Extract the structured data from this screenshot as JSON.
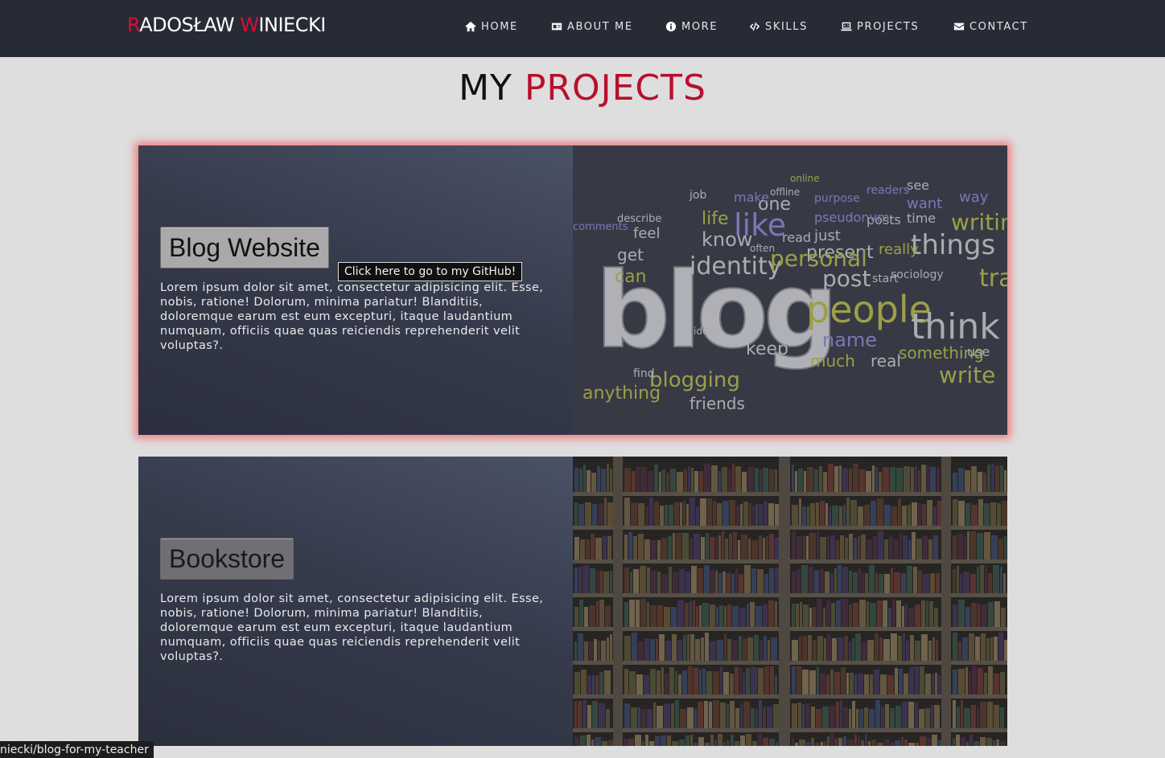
{
  "brand": {
    "first_initial": "R",
    "first_rest": "ADOSŁAW ",
    "last_initial": "W",
    "last_rest": "INIECKI"
  },
  "nav": {
    "items": [
      {
        "label": "HOME",
        "icon": "home-icon"
      },
      {
        "label": "ABOUT ME",
        "icon": "id-card-icon"
      },
      {
        "label": "MORE",
        "icon": "info-circle-icon"
      },
      {
        "label": "SKILLS",
        "icon": "code-icon"
      },
      {
        "label": "PROJECTS",
        "icon": "laptop-code-icon"
      },
      {
        "label": "CONTACT",
        "icon": "envelope-icon"
      }
    ]
  },
  "page": {
    "title_plain": "MY ",
    "title_accent": "PROJECTS"
  },
  "projects": [
    {
      "title": "Blog Website",
      "description": "Lorem ipsum dolor sit amet, consectetur adipisicing elit. Esse, nobis, ratione! Dolorum, minima pariatur! Blanditiis, doloremque earum est eum excepturi, itaque laudantium numquam, officiis quae quas reiciendis reprehenderit velit voluptas?.",
      "image": "blog-word-cloud",
      "highlighted": true
    },
    {
      "title": "Bookstore",
      "description": "Lorem ipsum dolor sit amet, consectetur adipisicing elit. Esse, nobis, ratione! Dolorum, minima pariatur! Blanditiis, doloremque earum est eum excepturi, itaque laudantium numquam, officiis quae quas reiciendis reprehenderit velit voluptas?.",
      "image": "bookshelf",
      "highlighted": false
    }
  ],
  "tooltip": "Click here to go to my GitHub!",
  "status_bar_url": "niecki/blog-for-my-teacher",
  "blog_words": [
    "blog",
    "people",
    "think",
    "things",
    "writing",
    "like",
    "identity",
    "know",
    "post",
    "present",
    "personal",
    "just",
    "keep",
    "blogging",
    "anything",
    "friends",
    "write",
    "something",
    "real",
    "much",
    "name",
    "can",
    "get",
    "feel",
    "life",
    "one",
    "make",
    "want",
    "way",
    "posts",
    "time",
    "readers",
    "see",
    "traff",
    "describe",
    "comments",
    "offline",
    "online",
    "start",
    "sociology",
    "really",
    "read",
    "use",
    "find",
    "job",
    "purpose",
    "pseudonym",
    "ideas",
    "often"
  ],
  "colors": {
    "nav_bg": "#262b36",
    "accent_red": "#d80f35",
    "page_bg": "#dedede",
    "glow": "#ff2828"
  }
}
